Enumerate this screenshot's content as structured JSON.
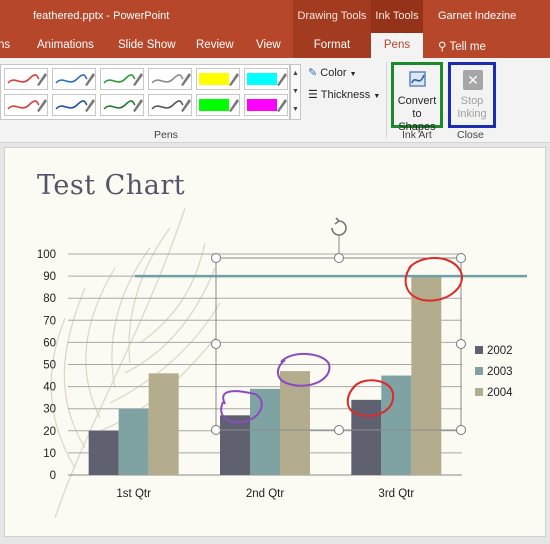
{
  "titlebar": {
    "filename": "feathered.pptx - PowerPoint",
    "drawing_tools": "Drawing Tools",
    "ink_tools": "Ink Tools",
    "user": "Garnet Indezine"
  },
  "tabs": {
    "animations": "Animations",
    "slideshow": "Slide Show",
    "review": "Review",
    "view": "View",
    "format": "Format",
    "pens": "Pens",
    "tellme": "Tell me",
    "partial_left": "ns"
  },
  "ribbon": {
    "pens_group_label": "Pens",
    "color_label": "Color",
    "thickness_label": "Thickness",
    "convert_label_1": "Convert",
    "convert_label_2": "to Shapes",
    "ink_art_label": "Ink Art",
    "stop_label_1": "Stop",
    "stop_label_2": "Inking",
    "close_label": "Close",
    "pen_colors": [
      "#e03a3a",
      "#2f6ec7",
      "#2e9a3c",
      "#8a8a8a",
      "#ffff00",
      "#00ffff",
      "#e03a3a",
      "#1f4fa8",
      "#1f7a2e",
      "#555555",
      "#00ff00",
      "#ff00ff"
    ]
  },
  "slide": {
    "title": "Test Chart"
  },
  "chart_data": {
    "type": "bar",
    "categories": [
      "1st Qtr",
      "2nd Qtr",
      "3rd Qtr"
    ],
    "series": [
      {
        "name": "2002",
        "values": [
          20,
          27,
          34
        ],
        "color": "#5f6070"
      },
      {
        "name": "2003",
        "values": [
          30,
          39,
          45
        ],
        "color": "#7fa3a2"
      },
      {
        "name": "2004",
        "values": [
          46,
          47,
          90
        ],
        "color": "#b3ad8d"
      }
    ],
    "ylim": [
      0,
      100
    ],
    "yticks": [
      "0",
      "10",
      "20",
      "30",
      "40",
      "50",
      "60",
      "70",
      "80",
      "90",
      "100"
    ],
    "grid": true,
    "legend": "right",
    "target_line_value": 90,
    "target_line_color": "#6ea0a8"
  }
}
